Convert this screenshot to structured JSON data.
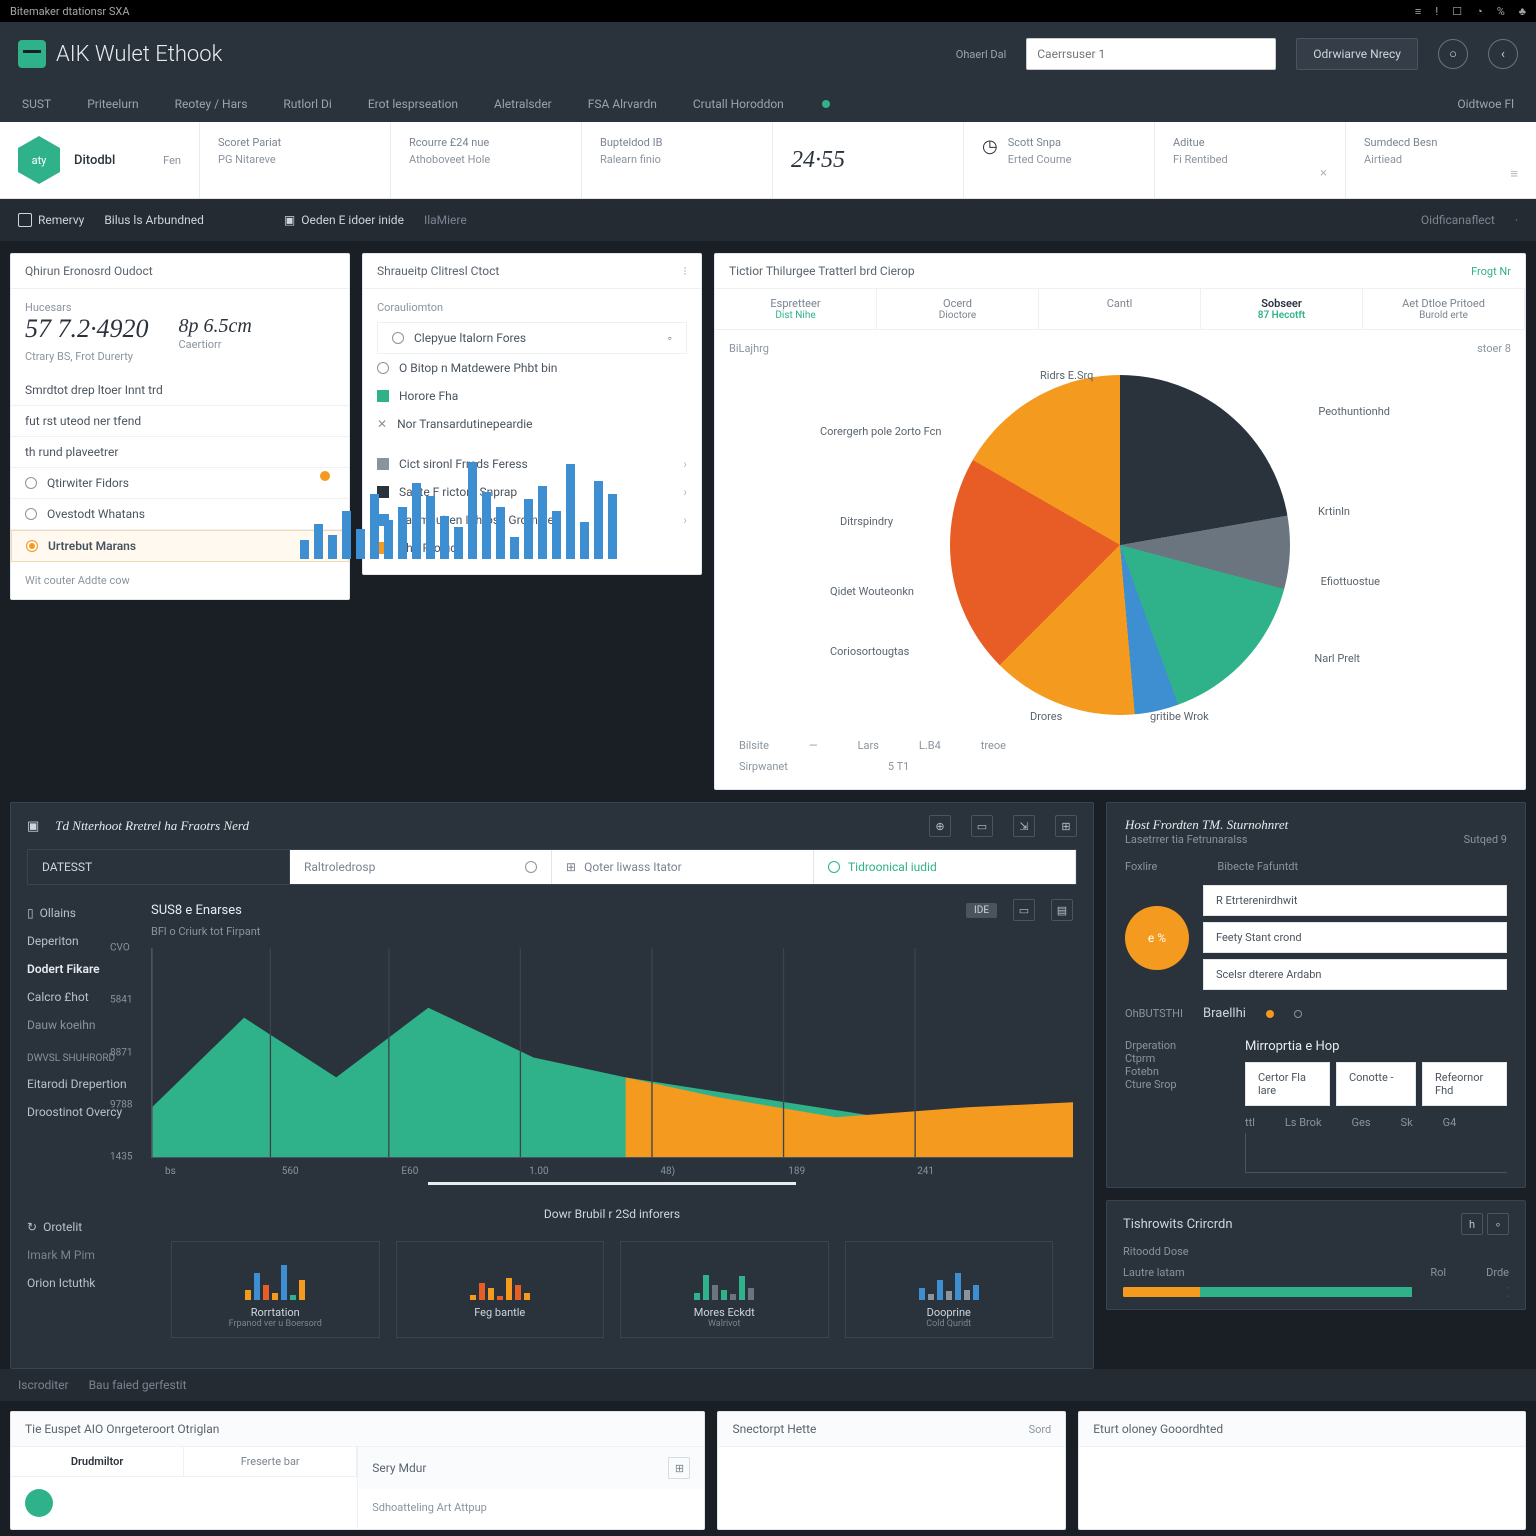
{
  "topstrip": {
    "left": "Bitemaker dtationsr SXA",
    "icons": [
      "≡",
      "!",
      "☐",
      "◔",
      "%",
      "♣"
    ]
  },
  "titlebar": {
    "brand": "AIK Wulet Ethook",
    "link": "Ohaerl Dal",
    "search_ph": "Caerrsuser 1",
    "btn": "Odrwiarve Nrecy"
  },
  "navbar": {
    "items": [
      "SUST",
      "Priteelurn",
      "Reotey / Hars",
      "Rutlorl Di",
      "Erot lesprseation",
      "Aletralsder",
      "FSA Alrvardn",
      "Crutall Horoddon"
    ],
    "right": "Oidtwoe Fl"
  },
  "stat": {
    "hex": "aty",
    "a_lbl": "Ditodbl",
    "a_r": "Fen",
    "b_lbl": "Scoret Pariat",
    "b_sub": "PG Nitareve",
    "c_lbl": "Rcourre £24 nue",
    "c_sub": "Athoboveet Hole",
    "d_lbl": "Bupteldod IB",
    "d_sub": "Ralearn finio",
    "e_val": "24·55",
    "f_lbl": "Scott Snpa",
    "f_sub": "Erted Courne",
    "g_lbl": "Aditue",
    "g_sub": "Fi Rentibed",
    "h_lbl": "Sumdecd Besn",
    "h_sub": "Airtiead"
  },
  "crumb": {
    "a": "Remervy",
    "b": "Bilus ls Arbundned",
    "c": "Oeden E idoer inide",
    "d": "IlaMiere",
    "r": "Oidficanaflect"
  },
  "leftcard": {
    "title": "Qhirun Eronosrd Oudoct",
    "kpi_lbl": "Hucesars",
    "kpi": "57 7.2·4920",
    "kpi2": "8p 6.5cm",
    "sub1": "Ctrary BS,  Frot Durerty",
    "sub2": "Caertiorr",
    "rows": [
      "Smrdtot drep ltoer Innt trd",
      "fut rst uteod ner tfend",
      "th rund plaveetrer",
      "Qtirwiter Fidors",
      "Ovestodt Whatans"
    ],
    "sel": "Urtrebut Marans",
    "foot": "Wit couter Addte cow"
  },
  "midcard": {
    "title": "Shraueitp Clitresl Ctoct",
    "sub": "Corauliomton",
    "r1": "Clepyue ltalorn Fores",
    "r2": "O Bitop n Matdewere Phbt bin",
    "r3": "Horore Fha",
    "r4": "Nor Transardutinepeardie",
    "leg": [
      "Cict sironl Frreds Feress",
      "Sadte F rictore Snprap",
      "Taomauiten Ilthrose Grompler",
      "Shd Rroluce"
    ]
  },
  "piecard": {
    "title": "Tictior Thilurgee Tratterl brd Cierop",
    "tabs": [
      "Espretteer",
      "Ocerd",
      "Cantl",
      "Sobseer",
      "Aet Dtloe Pritoed"
    ],
    "tabsub": [
      "Dist Nihe",
      "Dioctore",
      "",
      "87  Hecotft",
      "Burold erte"
    ],
    "lbls": [
      "Ridrs E.Srq",
      "Corergerh pole 2orto Fcn",
      "Ditrspindry",
      "Qidet Wouteonkn",
      "Coriosortougtas",
      "Drores",
      "gritibe Wrok",
      "Narl Prelt",
      "Efiottuostue",
      "Krtinln",
      "Peothuntionhd"
    ],
    "cols": [
      "Bilsite",
      "—",
      "Lars",
      "L.B4",
      "treoe"
    ],
    "sumlbl": "Sirpwanet",
    "sumval": "5 T1",
    "rlink": "Frogt Nr"
  },
  "darkp": {
    "title": "Td Ntterhoot Rretrel ha Fraotrs Nerd",
    "filters": [
      "DATESST",
      "Raltroledrosp",
      "Qoter liwass Itator",
      "Tidroonical iudid"
    ],
    "side_a": "Ollains",
    "side_items1": [
      "Deperiton",
      "Dodert Fikare",
      "Calcro £hot",
      "Dauw koeihn"
    ],
    "side_b": "Dwvsl Shuhrord",
    "side_items2": [
      "Eitarodi Drepertion",
      "Droostinot Overcy"
    ],
    "chart_title": "SUS8 e Enarses",
    "chart_sub": "BFl o Criurk tot Firpant",
    "badge": "IDE",
    "minis": [
      "Rorrtation",
      "Feg bantle",
      "Mores Eckdt",
      "Dooprine"
    ],
    "minisub": [
      "Frpanod ver u Boersord",
      "",
      "Walrivot",
      "Cold Quridt"
    ],
    "sec2": "Orotelit",
    "sec2a": "Imark M Pim",
    "sec2b": "Orion Ictuthk",
    "mtitle": "Dowr Brubil r 2Sd inforers"
  },
  "rpanel": {
    "title": "Host Frordten TM. Sturnohnret",
    "sub": "Lasetrrer tia Fetrunaralss",
    "rlink": "Sutqed 9",
    "hcol1": "Foxlire",
    "hcol2": "Bibecte Fafuntdt",
    "pct": "e %",
    "f1": "R Etrterenirdhwit",
    "f2": "Feety Stant crond",
    "f3": "Scelsr dterere Ardabn",
    "sec": "OhBUTSTHI",
    "bul": "Braellhi",
    "g_lbl": [
      "Drperation",
      "Ctprm",
      "Fotebn",
      "Cture Srop"
    ],
    "g_hdr": "Mirroprtia e Hop",
    "inp1": "Certor Fla lare",
    "inp2": "Conotte -",
    "inp3": "Refeornor Fhd",
    "ax": [
      "ttl",
      "Ls Brok",
      "Ges",
      "Sk",
      "G4"
    ]
  },
  "bottom": {
    "dark_l": "Iscroditer",
    "dark_r": "Bau faied gerfestit",
    "p1_title": "Tie Euspet AIO Onrgeteroort Otriglan",
    "p1_cols": [
      "Drudmiltor",
      "Freserte bar"
    ],
    "p1_right": "Sery Mdur",
    "p1_sub": "Sdhoatteling Art Attpup",
    "p2_title": "Snectorpt Hette",
    "p2_r": "Sord",
    "p3_title": "Eturt oloney Gooordhted",
    "p4_title": "Tishrowits Crircrdn",
    "p4_r": "hd ∘",
    "p4_sec": "Ritoodd Dose",
    "tbl_h": [
      "Lautre latam",
      "",
      "Rol",
      "Drde"
    ]
  },
  "chart_data": [
    {
      "type": "bar",
      "title": "mid-blue-bars",
      "values": [
        18,
        32,
        22,
        44,
        28,
        60,
        36,
        48,
        70,
        58,
        40,
        30,
        90,
        62,
        48,
        20,
        56,
        68,
        44,
        88,
        34,
        72,
        60
      ]
    },
    {
      "type": "pie",
      "title": "allocation",
      "series": [
        {
          "name": "dark",
          "value": 22
        },
        {
          "name": "grey",
          "value": 7
        },
        {
          "name": "teal",
          "value": 15
        },
        {
          "name": "blue",
          "value": 4
        },
        {
          "name": "orange-a",
          "value": 14
        },
        {
          "name": "red-orange",
          "value": 21
        },
        {
          "name": "orange-b",
          "value": 17
        }
      ]
    },
    {
      "type": "area",
      "title": "SUS8 e Enarses",
      "x": [
        0,
        50,
        60,
        100,
        140,
        189,
        241,
        320,
        390
      ],
      "series": [
        {
          "name": "teal",
          "values": [
            240,
            440,
            300,
            480,
            360,
            300,
            180,
            120,
            100
          ]
        },
        {
          "name": "orange",
          "values": [
            0,
            0,
            0,
            0,
            0,
            300,
            240,
            200,
            220
          ]
        }
      ],
      "ylabels": [
        "CVO",
        "5841",
        "8871",
        "9788",
        "1435"
      ],
      "xlabels": [
        "bs",
        "560",
        "E60",
        "1.00",
        "48)",
        "189",
        "241"
      ]
    },
    {
      "type": "bar",
      "title": "mini-1",
      "values": [
        20,
        55,
        30,
        15,
        70,
        10,
        40
      ],
      "color": "mixed"
    },
    {
      "type": "bar",
      "title": "mini-2",
      "values": [
        10,
        35,
        25,
        8,
        45,
        30,
        15
      ],
      "color": "orange"
    },
    {
      "type": "bar",
      "title": "mini-3",
      "values": [
        15,
        50,
        30,
        20,
        12,
        48,
        25
      ],
      "color": "teal"
    },
    {
      "type": "bar",
      "title": "mini-4",
      "values": [
        25,
        12,
        40,
        18,
        55,
        20,
        30
      ],
      "color": "blue"
    }
  ]
}
